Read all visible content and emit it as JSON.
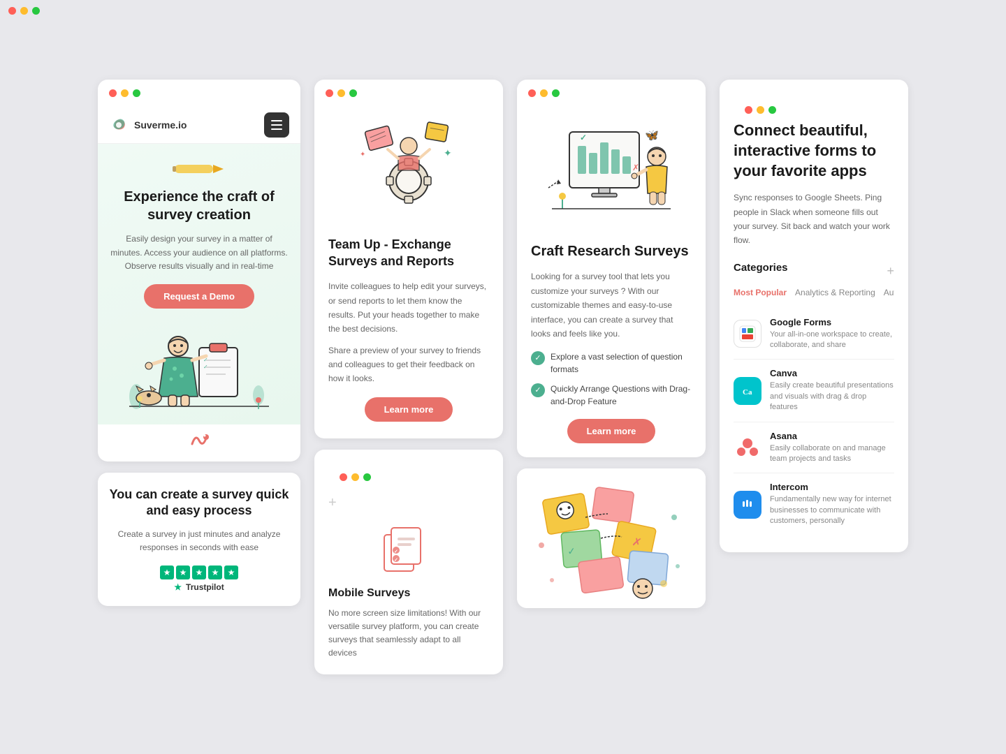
{
  "col1": {
    "app": {
      "logo_text": "Suverme.io",
      "menu_label": "menu"
    },
    "hero": {
      "title": "Experience the craft of survey creation",
      "description": "Easily design your survey in a matter of minutes. Access your audience on all platforms. Observe results visually and in real-time",
      "cta_label": "Request a Demo"
    },
    "section2": {
      "title": "You can create a survey quick and easy process",
      "description": "Create a survey in just minutes and analyze responses in seconds with ease",
      "trustpilot_label": "Trustpilot"
    }
  },
  "col2": {
    "feature": {
      "title": "Team Up - Exchange Surveys and Reports",
      "desc1": "Invite colleagues to help edit your surveys, or send reports to let them know the results. Put your heads together to make the best decisions.",
      "desc2": "Share a preview of your survey to friends and colleagues to get their feedback on how it looks.",
      "cta_label": "Learn more"
    },
    "mobile": {
      "title": "Mobile Surveys",
      "description": "No more screen size limitations! With our versatile survey platform, you can create surveys that seamlessly adapt to all devices"
    }
  },
  "col3": {
    "research": {
      "title": "Craft Research Surveys",
      "description": "Looking for a survey tool that lets you customize your surveys ? With our customizable themes and easy-to-use interface, you can create a survey that looks and feels like you.",
      "check_items": [
        "Explore a vast selection of question formats",
        "Quickly Arrange Questions with Drag-and-Drop Feature"
      ],
      "cta_label": "Learn more"
    }
  },
  "col4": {
    "title": "Connect beautiful, interactive forms to your favorite apps",
    "description": "Sync responses to Google Sheets. Ping people in Slack when someone fills out your survey. Sit back and watch your work flow.",
    "categories_label": "Categories",
    "category_tabs": [
      {
        "label": "Most Popular",
        "active": true
      },
      {
        "label": "Analytics & Reporting",
        "active": false
      },
      {
        "label": "Autom",
        "active": false
      }
    ],
    "integrations": [
      {
        "name": "Google Forms",
        "description": "Your all-in-one workspace to create, collaborate, and share",
        "icon_type": "notion"
      },
      {
        "name": "Canva",
        "description": "Easily create beautiful presentations and visuals with drag & drop features",
        "icon_type": "canva"
      },
      {
        "name": "Asana",
        "description": "Easily collaborate on and manage team projects and tasks",
        "icon_type": "asana"
      },
      {
        "name": "Intercom",
        "description": "Fundamentally new way for internet businesses to communicate with customers, personally",
        "icon_type": "intercom"
      }
    ]
  }
}
